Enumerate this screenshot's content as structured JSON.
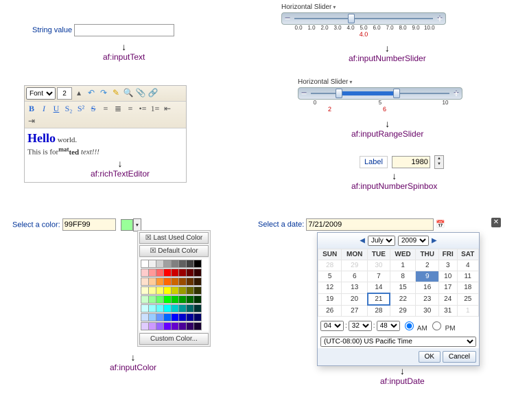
{
  "inputText": {
    "label": "String value",
    "component_label": "af:inputText",
    "value": ""
  },
  "slider1": {
    "label": "Horizontal Slider",
    "ticks": [
      "0.0",
      "1.0",
      "2.0",
      "3.0",
      "4.0",
      "5.0",
      "6.0",
      "7.0",
      "8.0",
      "9.0",
      "10.0"
    ],
    "value": "4.0",
    "component_label": "af:inputNumberSlider"
  },
  "slider2": {
    "label": "Horizontal Slider",
    "ticks": [
      "0",
      "5",
      "10"
    ],
    "low": "2",
    "high": "6",
    "component_label": "af:inputRangeSlider"
  },
  "rte": {
    "font": "Font",
    "size": "2",
    "sample_hello": "Hello",
    "sample_world": " world.",
    "sample_line": "This is for",
    "sample_mat": "mat",
    "sample_ted": "ted",
    "sample_suffix": " text!!!",
    "component_label": "af:richTextEditor"
  },
  "spinbox": {
    "label": "Label",
    "value": "1980",
    "component_label": "af:inputNumberSpinbox"
  },
  "color": {
    "label": "Select a color:",
    "value": "99FF99",
    "last_used": "Last Used Color",
    "default_color": "Default Color",
    "custom": "Custom Color...",
    "component_label": "af:inputColor",
    "colors": [
      "#ffffff",
      "#f0f0f0",
      "#d0d0d0",
      "#a0a0a0",
      "#808080",
      "#606060",
      "#404040",
      "#000000",
      "#ffcccc",
      "#ff9999",
      "#ff6666",
      "#ff0000",
      "#cc0000",
      "#990000",
      "#660000",
      "#330000",
      "#ffe0cc",
      "#ffcc99",
      "#ff9933",
      "#ff6600",
      "#cc6600",
      "#994c00",
      "#663300",
      "#331900",
      "#ffffcc",
      "#ffff99",
      "#ffff66",
      "#ffff00",
      "#cccc00",
      "#999900",
      "#666600",
      "#333300",
      "#ccffcc",
      "#99ff99",
      "#66ff66",
      "#00ff00",
      "#00cc00",
      "#009900",
      "#006600",
      "#003300",
      "#ccffff",
      "#99ffff",
      "#66ffff",
      "#00ffff",
      "#00cccc",
      "#009999",
      "#006666",
      "#003333",
      "#cce0ff",
      "#99ccff",
      "#6699ff",
      "#0066ff",
      "#0000ff",
      "#0000cc",
      "#000099",
      "#000066",
      "#e0ccff",
      "#cc99ff",
      "#9966ff",
      "#6600ff",
      "#6600cc",
      "#4c0099",
      "#330066",
      "#190033"
    ]
  },
  "date": {
    "label": "Select a date:",
    "value": "7/21/2009",
    "month": "July",
    "year": "2009",
    "days": [
      "SUN",
      "MON",
      "TUE",
      "WED",
      "THU",
      "FRI",
      "SAT"
    ],
    "weeks": [
      [
        "28",
        "29",
        "30",
        "1",
        "2",
        "3",
        "4"
      ],
      [
        "5",
        "6",
        "7",
        "8",
        "9",
        "10",
        "11"
      ],
      [
        "12",
        "13",
        "14",
        "15",
        "16",
        "17",
        "18"
      ],
      [
        "19",
        "20",
        "21",
        "22",
        "23",
        "24",
        "25"
      ],
      [
        "26",
        "27",
        "28",
        "29",
        "30",
        "31",
        "1"
      ]
    ],
    "hour": "04",
    "minute": "32",
    "second": "48",
    "am": "AM",
    "pm": "PM",
    "tz": "(UTC-08:00) US Pacific Time",
    "ok": "OK",
    "cancel": "Cancel",
    "component_label": "af:inputDate"
  }
}
